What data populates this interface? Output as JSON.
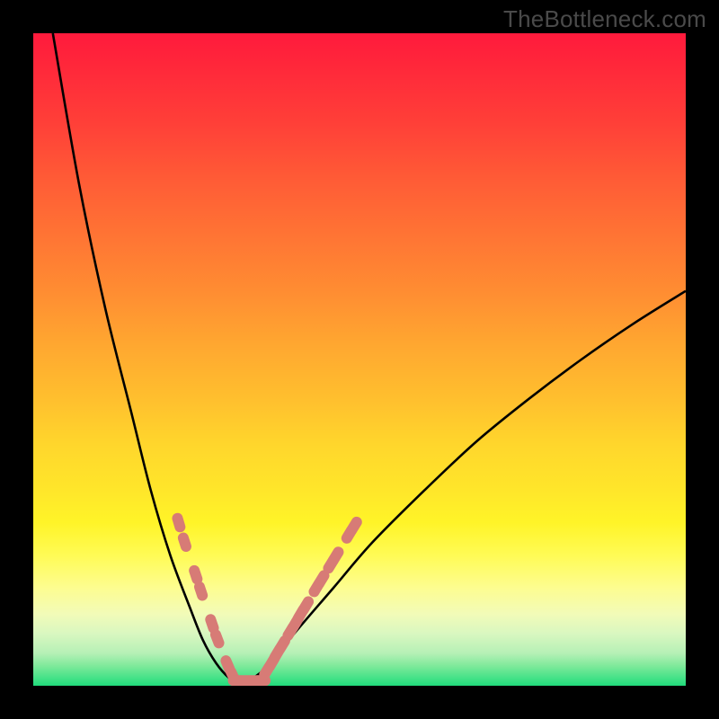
{
  "watermark": {
    "text": "TheBottleneck.com"
  },
  "chart_data": {
    "type": "line",
    "title": "",
    "xlabel": "",
    "ylabel": "",
    "xlim": [
      0,
      100
    ],
    "ylim": [
      0,
      100
    ],
    "legend": false,
    "grid": false,
    "background_gradient": {
      "direction": "vertical",
      "stops": [
        {
          "pos": 0.0,
          "color": "#ff1a3c"
        },
        {
          "pos": 0.5,
          "color": "#ffb030"
        },
        {
          "pos": 0.8,
          "color": "#fffb55"
        },
        {
          "pos": 1.0,
          "color": "#21db7c"
        }
      ]
    },
    "series": [
      {
        "name": "bottleneck-curve-left",
        "color": "#000000",
        "x": [
          3,
          7,
          11,
          15,
          18,
          21,
          24,
          26,
          28,
          30,
          32
        ],
        "y": [
          100,
          77,
          58,
          42,
          30,
          20,
          12,
          7,
          3.5,
          1.2,
          0
        ]
      },
      {
        "name": "bottleneck-curve-right",
        "color": "#000000",
        "x": [
          32,
          36,
          40,
          46,
          52,
          60,
          68,
          76,
          84,
          92,
          100
        ],
        "y": [
          0,
          3,
          8,
          15,
          22,
          30,
          37.5,
          44,
          50,
          55.5,
          60.5
        ]
      }
    ],
    "markers": {
      "color": "#d77b76",
      "shape": "rounded-lozenge",
      "points_left_branch": [
        {
          "x": 22.3,
          "y": 25.0
        },
        {
          "x": 23.2,
          "y": 22.0
        },
        {
          "x": 24.9,
          "y": 17.0
        },
        {
          "x": 25.7,
          "y": 14.5
        },
        {
          "x": 27.4,
          "y": 9.5
        },
        {
          "x": 28.2,
          "y": 7.2
        },
        {
          "x": 29.8,
          "y": 3.2
        },
        {
          "x": 30.6,
          "y": 1.5
        }
      ],
      "points_bottom": [
        {
          "x": 31.2,
          "y": 0.8
        },
        {
          "x": 32.5,
          "y": 0.8
        },
        {
          "x": 33.8,
          "y": 0.8
        },
        {
          "x": 35.0,
          "y": 0.8
        }
      ],
      "points_right_branch": [
        {
          "x": 35.8,
          "y": 2.3
        },
        {
          "x": 36.6,
          "y": 3.6
        },
        {
          "x": 37.4,
          "y": 5.0
        },
        {
          "x": 38.2,
          "y": 6.3
        },
        {
          "x": 39.4,
          "y": 8.3
        },
        {
          "x": 40.2,
          "y": 9.6
        },
        {
          "x": 41.0,
          "y": 11.0
        },
        {
          "x": 41.8,
          "y": 12.3
        },
        {
          "x": 43.4,
          "y": 15.0
        },
        {
          "x": 44.2,
          "y": 16.3
        },
        {
          "x": 45.6,
          "y": 18.6
        },
        {
          "x": 46.4,
          "y": 19.9
        },
        {
          "x": 48.4,
          "y": 23.2
        },
        {
          "x": 49.2,
          "y": 24.5
        }
      ]
    }
  }
}
